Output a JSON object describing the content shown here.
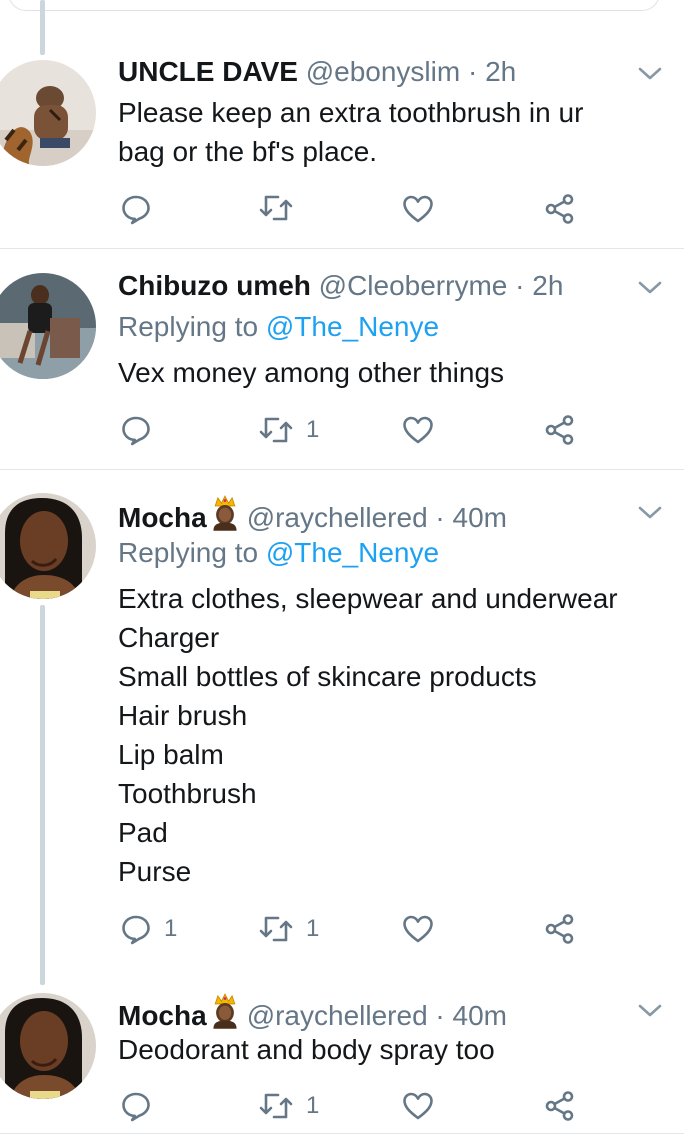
{
  "tweets": [
    {
      "name": "UNCLE DAVE",
      "handle": "@ebonyslim",
      "time": "2h",
      "replying_label": "",
      "replying_handle": "",
      "body": "Please keep an extra toothbrush in ur\nbag or the bf's place.",
      "reply_count": "",
      "retweet_count": "",
      "like_count": ""
    },
    {
      "name": "Chibuzo umeh",
      "handle": "@Cleoberryme",
      "time": "2h",
      "replying_label": "Replying to",
      "replying_handle": "@The_Nenye",
      "body": "Vex money among other things",
      "reply_count": "",
      "retweet_count": "1",
      "like_count": ""
    },
    {
      "name": "Mocha",
      "handle": "@raychellered",
      "time": "40m",
      "replying_label": "Replying to",
      "replying_handle": "@The_Nenye",
      "body": "Extra clothes, sleepwear and underwear\nCharger\nSmall bottles of skincare products\nHair brush\nLip balm\nToothbrush\nPad\nPurse",
      "reply_count": "1",
      "retweet_count": "1",
      "like_count": ""
    },
    {
      "name": "Mocha",
      "handle": "@raychellered",
      "time": "40m",
      "replying_label": "",
      "replying_handle": "",
      "body": "Deodorant and body spray too",
      "reply_count": "",
      "retweet_count": "1",
      "like_count": ""
    }
  ],
  "separator": "·",
  "icons": {
    "reply": "reply-icon",
    "retweet": "retweet-icon",
    "like": "heart-icon",
    "share": "share-icon",
    "menu": "chevron-down-icon",
    "badge": "crown-emoji-icon"
  },
  "colors": {
    "text": "#14171a",
    "secondary": "#657786",
    "link": "#1da1f2",
    "divider": "#e1e8ed",
    "thread": "#ccd6dd"
  }
}
